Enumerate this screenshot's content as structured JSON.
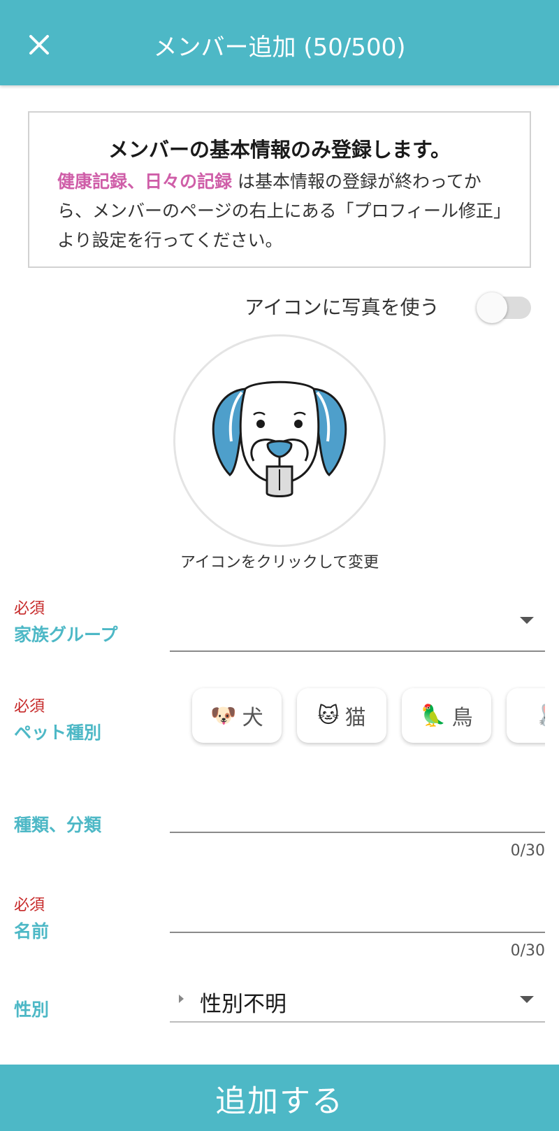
{
  "header": {
    "title": "メンバー追加 (50/500)",
    "close_icon": "close-icon",
    "background_color": "#4db8c6"
  },
  "notice": {
    "title": "メンバーの基本情報のみ登録します。",
    "highlight": "健康記録、日々の記録",
    "body": " は基本情報の登録が終わってから、メンバーのページの右上にある「プロフィール修正」より設定を行ってください。",
    "highlight_color": "#cf5ea8"
  },
  "photo_toggle": {
    "label": "アイコンに写真を使う",
    "checked": false
  },
  "avatar": {
    "icon": "dog-face-icon",
    "caption": "アイコンをクリックして変更"
  },
  "form": {
    "required_label": "必須",
    "family_group": {
      "label": "家族グループ",
      "required": true,
      "value": ""
    },
    "pet_type": {
      "label": "ペット種別",
      "required": true,
      "options": [
        {
          "emoji": "🐶",
          "label": "犬"
        },
        {
          "emoji": "🐱",
          "label": "猫"
        },
        {
          "emoji": "🦜",
          "label": "鳥"
        },
        {
          "emoji": "🐰",
          "label": ""
        }
      ]
    },
    "breed": {
      "label": "種類、分類",
      "required": false,
      "value": "",
      "counter": "0/30"
    },
    "name": {
      "label": "名前",
      "required": true,
      "value": "",
      "counter": "0/30"
    },
    "gender": {
      "label": "性別",
      "required": false,
      "value": "性別不明"
    }
  },
  "submit": {
    "label": "追加する"
  }
}
